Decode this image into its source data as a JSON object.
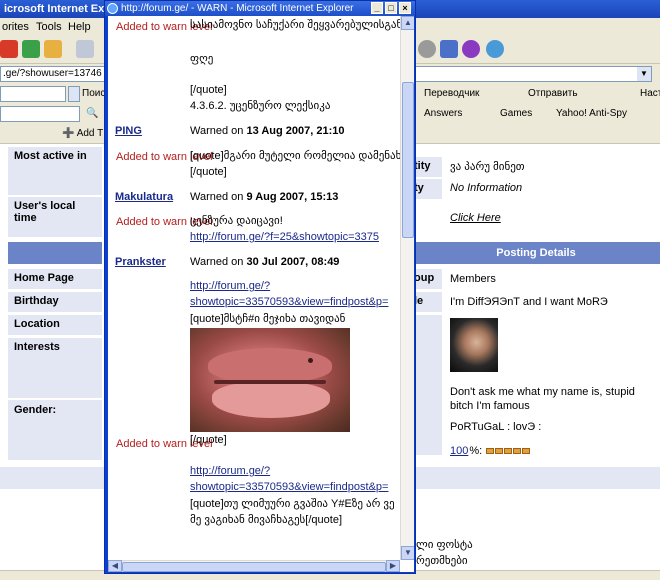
{
  "background_browser": {
    "title": "icrosoft Internet Explorer",
    "menu": [
      "orites",
      "Tools",
      "Help"
    ],
    "address": ".ge/?showuser=13746",
    "toolbar2": {
      "left_label": "Поис",
      "translator": "Переводчик",
      "send": "Отправить",
      "settings": "Наст"
    },
    "toolbar3": {
      "answers": "Answers",
      "games": "Games",
      "yahoo": "Yahoo! Anti-Spy"
    },
    "toolbar4": {
      "add": "Add T"
    }
  },
  "profile": {
    "left_rows": {
      "most_active": "Most active in",
      "local_time": "User's local time",
      "home_page": "Home Page",
      "birthday": "Birthday",
      "location": "Location",
      "interests": "Interests",
      "gender": "Gender:"
    },
    "right": {
      "activity_label": "tity",
      "activity_value": "ვა პარუ მინეთ",
      "ty_label": "ty",
      "ty_value": "No Information",
      "click_here": "Click Here",
      "posting_details": "Posting Details",
      "group_label": "oup",
      "group_value": "Members",
      "le_label": "le",
      "le_value": "I'm DiffЭЯЭnT and I want MoRЭ",
      "about": "Don't ask me what my name is, stupid bitch I'm famous",
      "portugal": "PoRTuGaL : lovЭ :",
      "percent": "100",
      "percent_suffix": "%:",
      "bottom_1": "ლი ფოსტა",
      "bottom_2": "რეთმხები"
    }
  },
  "popup": {
    "title": "http://forum.ge/ - WARN - Microsoft Internet Explorer",
    "entries": [
      {
        "label": "Added to warn level",
        "lines": [
          "სასიამოვნო საჩუქარი შეყვარებულისგან[/",
          "ფღე",
          "[/quote]",
          "4.3.6.2. უცენზურო ლექსიკა"
        ]
      },
      {
        "name": "PING",
        "warned_prefix": "Warned on",
        "date": "13 Aug 2007, 21:10",
        "label": "Added to warn level",
        "lines": [
          "[quote]მგარი მუტელი რომელია დამენახ",
          "[/quote]"
        ]
      },
      {
        "name": "Makulatura",
        "warned_prefix": "Warned on",
        "date": "9 Aug 2007, 15:13",
        "label": "Added to warn level",
        "lines": [
          "ცენზურა დაიცავი!"
        ],
        "link": "http://forum.ge/?f=25&showtopic=3375"
      },
      {
        "name": "Prankster",
        "warned_prefix": "Warned on",
        "date": "30 Jul 2007, 08:49",
        "label": "Added to warn level",
        "link1a": "http://forum.ge/?",
        "link1b": "showtopic=33570593&view=findpost&p=",
        "quote_line": "[quote]მსტჩ#ი მეჯიხა თავიდან",
        "after_img": "[/quote]",
        "link2a": "http://forum.ge/?",
        "link2b": "showtopic=33570593&view=findpost&p=",
        "tail1": "[quote]თუ ლიმუური გვაშია Y#Eზე არ ვე",
        "tail2": "მე ვაგიხან მივაჩხაგეს[/quote]"
      }
    ]
  },
  "colors": {
    "label_red": "#b41e1e",
    "link_blue": "#1a2a8a",
    "header_blue": "#6b84c8",
    "titlebar_blue": "#1d4fc9"
  }
}
